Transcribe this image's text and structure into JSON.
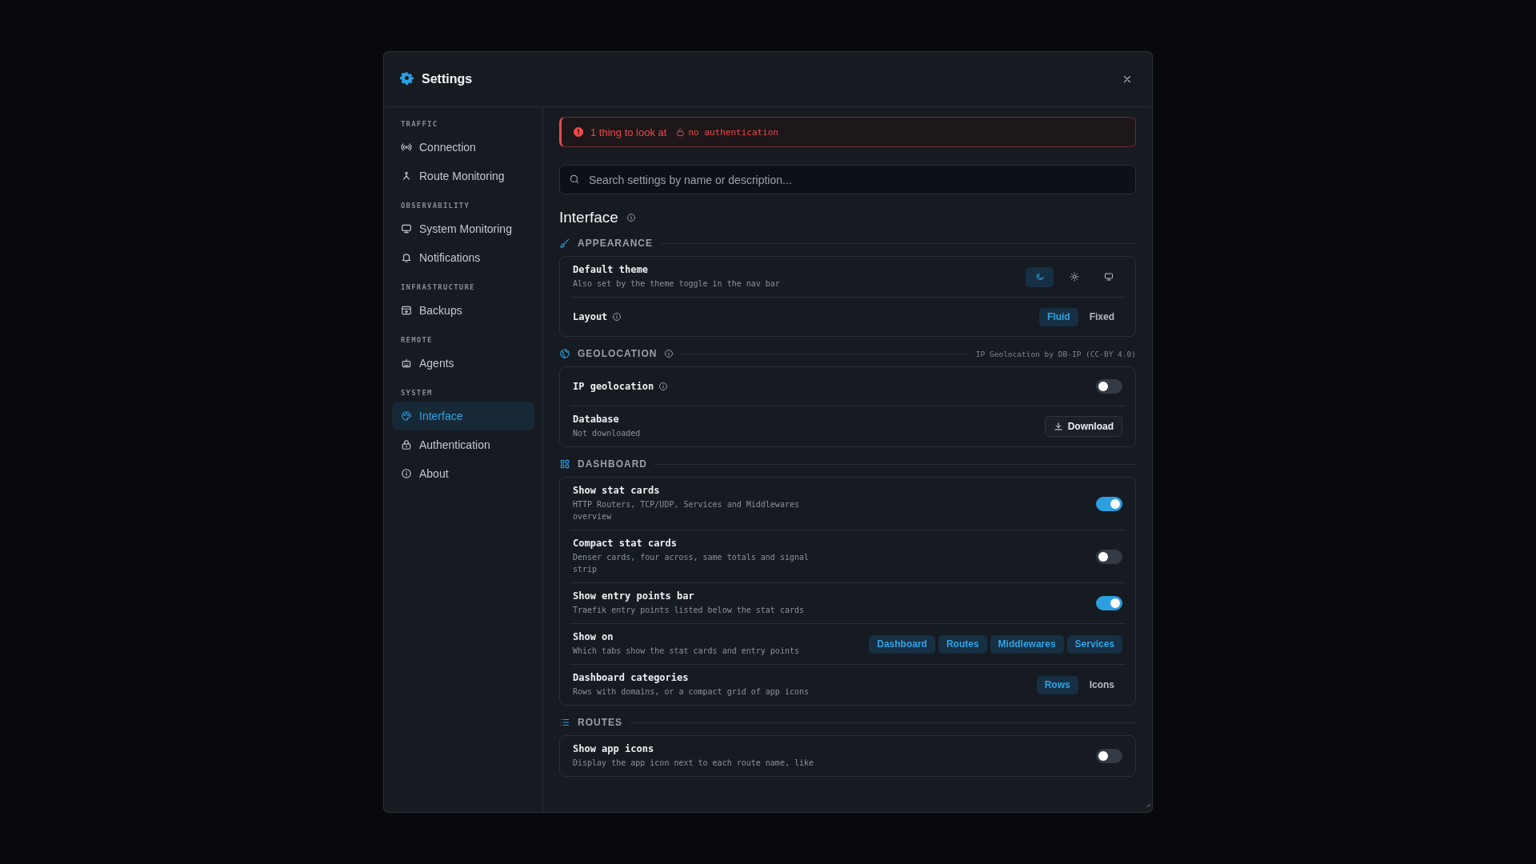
{
  "dialog": {
    "title": "Settings"
  },
  "sidebar": {
    "groups": [
      {
        "heading": "TRAFFIC",
        "items": [
          {
            "label": "Connection",
            "selected": false
          },
          {
            "label": "Route Monitoring",
            "selected": false
          }
        ]
      },
      {
        "heading": "OBSERVABILITY",
        "items": [
          {
            "label": "System Monitoring",
            "selected": false
          },
          {
            "label": "Notifications",
            "selected": false
          }
        ]
      },
      {
        "heading": "INFRASTRUCTURE",
        "items": [
          {
            "label": "Backups",
            "selected": false
          }
        ]
      },
      {
        "heading": "REMOTE",
        "items": [
          {
            "label": "Agents",
            "selected": false
          }
        ]
      },
      {
        "heading": "SYSTEM",
        "items": [
          {
            "label": "Interface",
            "selected": true
          },
          {
            "label": "Authentication",
            "selected": false
          },
          {
            "label": "About",
            "selected": false
          }
        ]
      }
    ]
  },
  "alert": {
    "text": "1 thing to look at",
    "tag": "no authentication"
  },
  "search": {
    "placeholder": "Search settings by name or description..."
  },
  "page": {
    "title": "Interface",
    "info": true
  },
  "sections": [
    {
      "title": "APPEARANCE",
      "rows": [
        {
          "kind": "icon_segment",
          "label": "Default theme",
          "description": "Also set by the theme toggle in the nav bar",
          "options": [
            {
              "selected": true
            },
            {
              "selected": false
            },
            {
              "selected": false
            }
          ]
        },
        {
          "kind": "segment",
          "label": "Layout",
          "info": true,
          "options": [
            {
              "label": "Fluid",
              "selected": true
            },
            {
              "label": "Fixed",
              "selected": false
            }
          ]
        }
      ]
    },
    {
      "title": "GEOLOCATION",
      "info": true,
      "note": "IP Geolocation by DB-IP (CC-BY 4.0)",
      "rows": [
        {
          "kind": "toggle",
          "label": "IP geolocation",
          "info": true,
          "on": false
        },
        {
          "kind": "button",
          "label": "Database",
          "description": "Not downloaded",
          "button": "Download"
        }
      ]
    },
    {
      "title": "DASHBOARD",
      "rows": [
        {
          "kind": "toggle",
          "label": "Show stat cards",
          "description": "HTTP Routers, TCP/UDP, Services and Middlewares overview",
          "on": true
        },
        {
          "kind": "toggle",
          "label": "Compact stat cards",
          "description": "Denser cards, four across, same totals and signal strip",
          "on": false
        },
        {
          "kind": "toggle",
          "label": "Show entry points bar",
          "description": "Traefik entry points listed below the stat cards",
          "on": true
        },
        {
          "kind": "segment",
          "label": "Show on",
          "description": "Which tabs show the stat cards and entry points",
          "options": [
            {
              "label": "Dashboard",
              "selected": true
            },
            {
              "label": "Routes",
              "selected": true
            },
            {
              "label": "Middlewares",
              "selected": true
            },
            {
              "label": "Services",
              "selected": true
            }
          ]
        },
        {
          "kind": "segment",
          "label": "Dashboard categories",
          "description": "Rows with domains, or a compact grid of app icons",
          "options": [
            {
              "label": "Rows",
              "selected": true
            },
            {
              "label": "Icons",
              "selected": false
            }
          ]
        }
      ]
    },
    {
      "title": "ROUTES",
      "rows": [
        {
          "kind": "toggle",
          "label": "Show app icons",
          "description": "Display the app icon next to each route name, like",
          "on": false
        }
      ]
    }
  ]
}
